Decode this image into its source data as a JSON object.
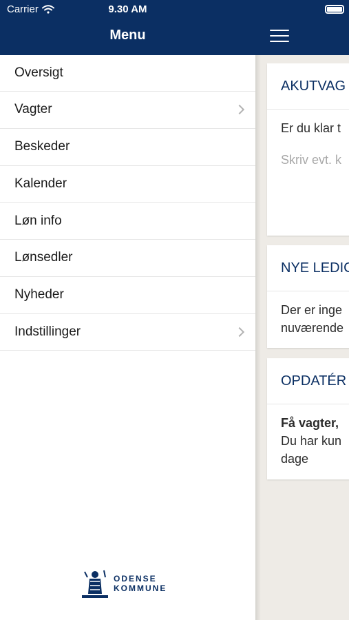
{
  "status_bar": {
    "carrier": "Carrier",
    "time": "9.30 AM"
  },
  "nav": {
    "title": "Menu"
  },
  "menu": {
    "items": [
      {
        "label": "Oversigt",
        "has_chevron": false
      },
      {
        "label": "Vagter",
        "has_chevron": true
      },
      {
        "label": "Beskeder",
        "has_chevron": false
      },
      {
        "label": "Kalender",
        "has_chevron": false
      },
      {
        "label": "Løn info",
        "has_chevron": false
      },
      {
        "label": "Lønsedler",
        "has_chevron": false
      },
      {
        "label": "Nyheder",
        "has_chevron": false
      },
      {
        "label": "Indstillinger",
        "has_chevron": true
      }
    ]
  },
  "logo": {
    "line1": "ODENSE",
    "line2": "KOMMUNE"
  },
  "cards": [
    {
      "title": "AKUTVAG",
      "text": "Er du klar t",
      "placeholder": "Skriv evt. k"
    },
    {
      "title": "NYE LEDIC",
      "line1": "Der er inge",
      "line2": "nuværende"
    },
    {
      "title": "OPDATÉR",
      "bold_line": "Få vagter,",
      "line1": "Du har kun",
      "line2": "dage"
    }
  ],
  "colors": {
    "brand": "#0b2f63",
    "content_bg": "#eeebe6"
  },
  "icons": [
    "wifi-icon",
    "battery-icon",
    "hamburger-icon",
    "chevron-right-icon"
  ]
}
